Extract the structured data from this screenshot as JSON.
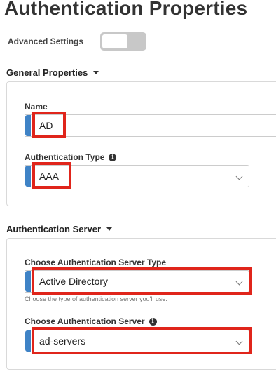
{
  "page": {
    "title": "Authentication Properties"
  },
  "advanced": {
    "label": "Advanced Settings",
    "enabled": false
  },
  "general": {
    "header": "General Properties",
    "name": {
      "label": "Name",
      "value": "AD"
    },
    "auth_type": {
      "label": "Authentication Type",
      "value": "AAA"
    }
  },
  "server": {
    "header": "Authentication Server",
    "server_type": {
      "label": "Choose Authentication Server Type",
      "value": "Active Directory",
      "help": "Choose the type of authentication server you'll use."
    },
    "server": {
      "label": "Choose Authentication Server",
      "value": "ad-servers"
    }
  },
  "colors": {
    "accent": "#3f83c6",
    "highlight": "#e0251b"
  },
  "icons": {
    "info": "info-icon",
    "dropdown": "chevron-down-icon",
    "collapse": "caret-down-icon"
  }
}
